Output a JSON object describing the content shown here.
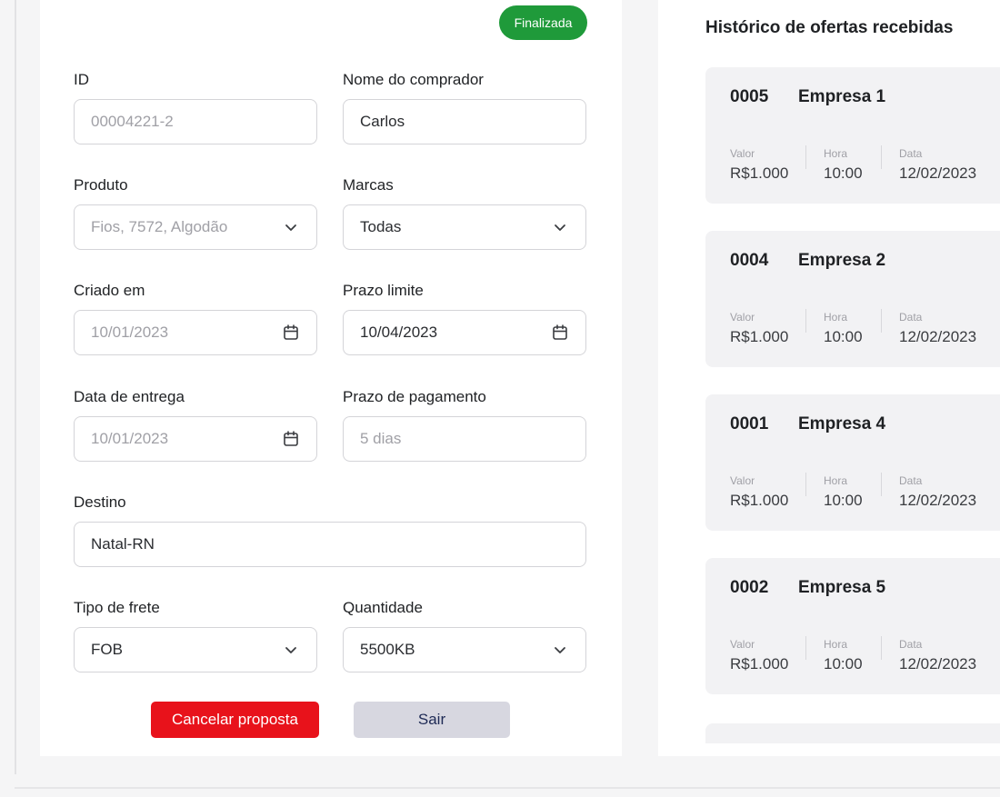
{
  "form": {
    "status_badge": "Finalizada",
    "id": {
      "label": "ID",
      "value": "00004221-2"
    },
    "buyer": {
      "label": "Nome do comprador",
      "value": "Carlos"
    },
    "product": {
      "label": "Produto",
      "value": "Fios, 7572, Algodão"
    },
    "brands": {
      "label": "Marcas",
      "value": "Todas"
    },
    "created": {
      "label": "Criado em",
      "value": "10/01/2023"
    },
    "deadline": {
      "label": "Prazo limite",
      "value": "10/04/2023"
    },
    "delivery": {
      "label": "Data de entrega",
      "value": "10/01/2023"
    },
    "payment": {
      "label": "Prazo de pagamento",
      "value": "5 dias"
    },
    "destination": {
      "label": "Destino",
      "value": "Natal-RN"
    },
    "freight": {
      "label": "Tipo de frete",
      "value": "FOB"
    },
    "quantity": {
      "label": "Quantidade",
      "value": "5500KB"
    },
    "cancel_label": "Cancelar proposta",
    "exit_label": "Sair"
  },
  "history": {
    "title": "Histórico de ofertas recebidas",
    "col_labels": {
      "value": "Valor",
      "time": "Hora",
      "date": "Data"
    },
    "offers": [
      {
        "id": "0005",
        "company": "Empresa 1",
        "value": "R$1.000",
        "time": "10:00",
        "date": "12/02/2023"
      },
      {
        "id": "0004",
        "company": "Empresa 2",
        "value": "R$1.000",
        "time": "10:00",
        "date": "12/02/2023"
      },
      {
        "id": "0001",
        "company": "Empresa 4",
        "value": "R$1.000",
        "time": "10:00",
        "date": "12/02/2023"
      },
      {
        "id": "0002",
        "company": "Empresa 5",
        "value": "R$1.000",
        "time": "10:00",
        "date": "12/02/2023"
      }
    ]
  },
  "icons": {
    "dropdown": "chevron-down-icon",
    "date": "calendar-icon"
  },
  "colors": {
    "status_green": "#1f9a3a",
    "cancel_red": "#e8121b",
    "exit_gray": "#d7d7e0",
    "exit_text": "#1e2a55"
  }
}
